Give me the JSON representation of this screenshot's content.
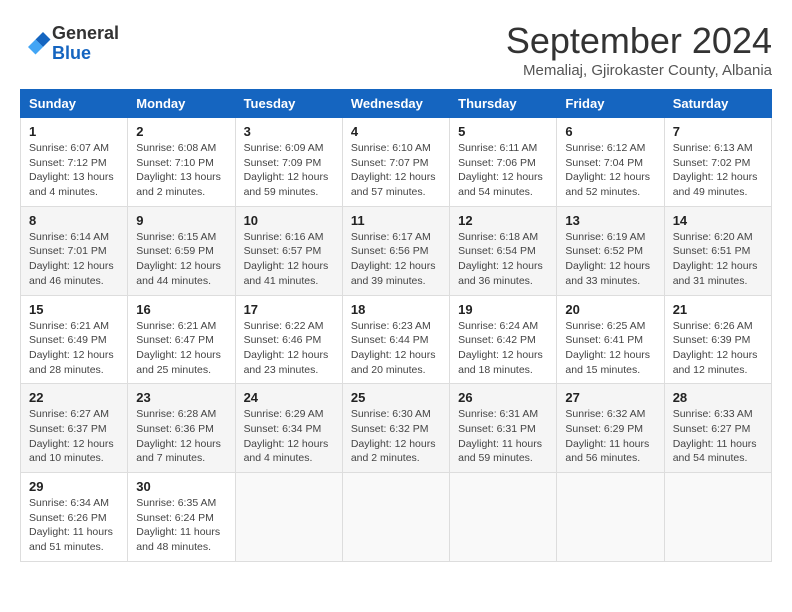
{
  "header": {
    "logo_general": "General",
    "logo_blue": "Blue",
    "month_title": "September 2024",
    "subtitle": "Memaliaj, Gjirokaster County, Albania"
  },
  "calendar": {
    "headers": [
      "Sunday",
      "Monday",
      "Tuesday",
      "Wednesday",
      "Thursday",
      "Friday",
      "Saturday"
    ],
    "weeks": [
      [
        {
          "day": "1",
          "detail": "Sunrise: 6:07 AM\nSunset: 7:12 PM\nDaylight: 13 hours\nand 4 minutes."
        },
        {
          "day": "2",
          "detail": "Sunrise: 6:08 AM\nSunset: 7:10 PM\nDaylight: 13 hours\nand 2 minutes."
        },
        {
          "day": "3",
          "detail": "Sunrise: 6:09 AM\nSunset: 7:09 PM\nDaylight: 12 hours\nand 59 minutes."
        },
        {
          "day": "4",
          "detail": "Sunrise: 6:10 AM\nSunset: 7:07 PM\nDaylight: 12 hours\nand 57 minutes."
        },
        {
          "day": "5",
          "detail": "Sunrise: 6:11 AM\nSunset: 7:06 PM\nDaylight: 12 hours\nand 54 minutes."
        },
        {
          "day": "6",
          "detail": "Sunrise: 6:12 AM\nSunset: 7:04 PM\nDaylight: 12 hours\nand 52 minutes."
        },
        {
          "day": "7",
          "detail": "Sunrise: 6:13 AM\nSunset: 7:02 PM\nDaylight: 12 hours\nand 49 minutes."
        }
      ],
      [
        {
          "day": "8",
          "detail": "Sunrise: 6:14 AM\nSunset: 7:01 PM\nDaylight: 12 hours\nand 46 minutes."
        },
        {
          "day": "9",
          "detail": "Sunrise: 6:15 AM\nSunset: 6:59 PM\nDaylight: 12 hours\nand 44 minutes."
        },
        {
          "day": "10",
          "detail": "Sunrise: 6:16 AM\nSunset: 6:57 PM\nDaylight: 12 hours\nand 41 minutes."
        },
        {
          "day": "11",
          "detail": "Sunrise: 6:17 AM\nSunset: 6:56 PM\nDaylight: 12 hours\nand 39 minutes."
        },
        {
          "day": "12",
          "detail": "Sunrise: 6:18 AM\nSunset: 6:54 PM\nDaylight: 12 hours\nand 36 minutes."
        },
        {
          "day": "13",
          "detail": "Sunrise: 6:19 AM\nSunset: 6:52 PM\nDaylight: 12 hours\nand 33 minutes."
        },
        {
          "day": "14",
          "detail": "Sunrise: 6:20 AM\nSunset: 6:51 PM\nDaylight: 12 hours\nand 31 minutes."
        }
      ],
      [
        {
          "day": "15",
          "detail": "Sunrise: 6:21 AM\nSunset: 6:49 PM\nDaylight: 12 hours\nand 28 minutes."
        },
        {
          "day": "16",
          "detail": "Sunrise: 6:21 AM\nSunset: 6:47 PM\nDaylight: 12 hours\nand 25 minutes."
        },
        {
          "day": "17",
          "detail": "Sunrise: 6:22 AM\nSunset: 6:46 PM\nDaylight: 12 hours\nand 23 minutes."
        },
        {
          "day": "18",
          "detail": "Sunrise: 6:23 AM\nSunset: 6:44 PM\nDaylight: 12 hours\nand 20 minutes."
        },
        {
          "day": "19",
          "detail": "Sunrise: 6:24 AM\nSunset: 6:42 PM\nDaylight: 12 hours\nand 18 minutes."
        },
        {
          "day": "20",
          "detail": "Sunrise: 6:25 AM\nSunset: 6:41 PM\nDaylight: 12 hours\nand 15 minutes."
        },
        {
          "day": "21",
          "detail": "Sunrise: 6:26 AM\nSunset: 6:39 PM\nDaylight: 12 hours\nand 12 minutes."
        }
      ],
      [
        {
          "day": "22",
          "detail": "Sunrise: 6:27 AM\nSunset: 6:37 PM\nDaylight: 12 hours\nand 10 minutes."
        },
        {
          "day": "23",
          "detail": "Sunrise: 6:28 AM\nSunset: 6:36 PM\nDaylight: 12 hours\nand 7 minutes."
        },
        {
          "day": "24",
          "detail": "Sunrise: 6:29 AM\nSunset: 6:34 PM\nDaylight: 12 hours\nand 4 minutes."
        },
        {
          "day": "25",
          "detail": "Sunrise: 6:30 AM\nSunset: 6:32 PM\nDaylight: 12 hours\nand 2 minutes."
        },
        {
          "day": "26",
          "detail": "Sunrise: 6:31 AM\nSunset: 6:31 PM\nDaylight: 11 hours\nand 59 minutes."
        },
        {
          "day": "27",
          "detail": "Sunrise: 6:32 AM\nSunset: 6:29 PM\nDaylight: 11 hours\nand 56 minutes."
        },
        {
          "day": "28",
          "detail": "Sunrise: 6:33 AM\nSunset: 6:27 PM\nDaylight: 11 hours\nand 54 minutes."
        }
      ],
      [
        {
          "day": "29",
          "detail": "Sunrise: 6:34 AM\nSunset: 6:26 PM\nDaylight: 11 hours\nand 51 minutes."
        },
        {
          "day": "30",
          "detail": "Sunrise: 6:35 AM\nSunset: 6:24 PM\nDaylight: 11 hours\nand 48 minutes."
        },
        {
          "day": "",
          "detail": ""
        },
        {
          "day": "",
          "detail": ""
        },
        {
          "day": "",
          "detail": ""
        },
        {
          "day": "",
          "detail": ""
        },
        {
          "day": "",
          "detail": ""
        }
      ]
    ]
  }
}
